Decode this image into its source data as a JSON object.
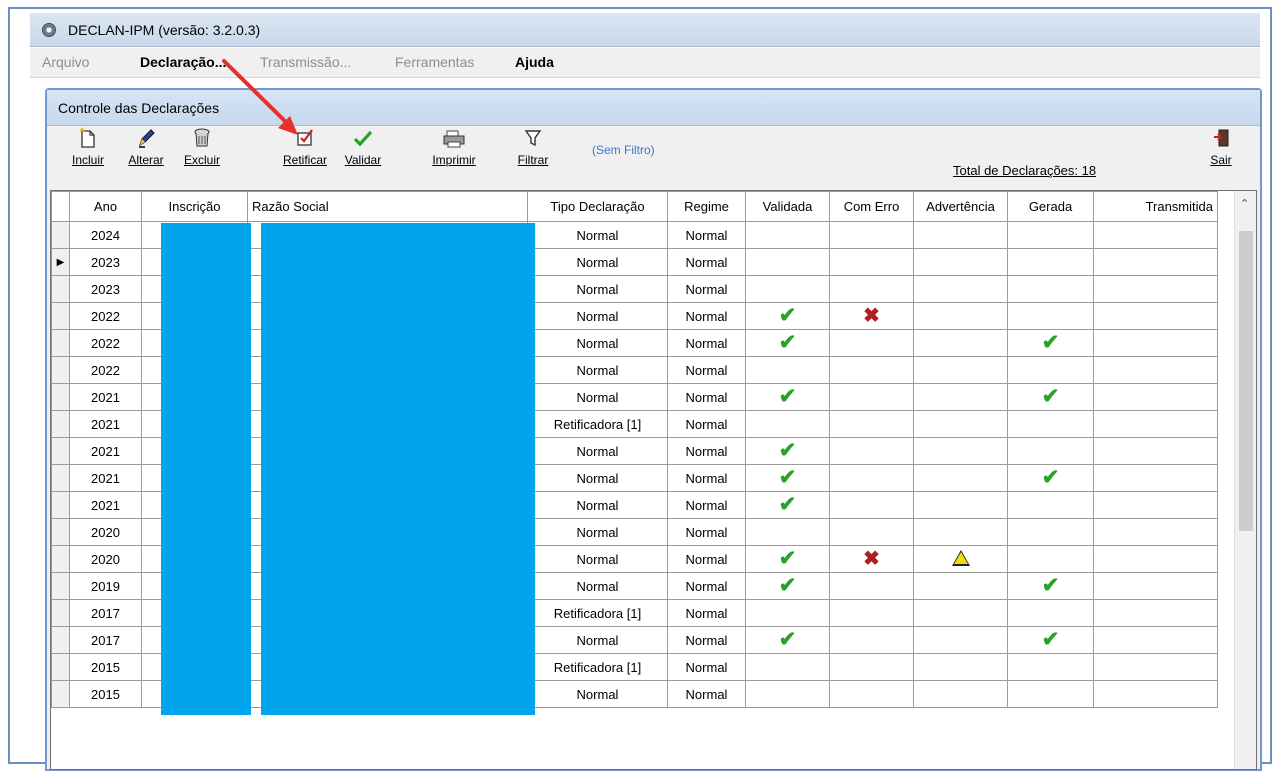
{
  "window": {
    "title": "DECLAN-IPM (versão: 3.2.0.3)"
  },
  "menu": [
    {
      "label": "Arquivo",
      "state": "disabled"
    },
    {
      "label": "Declaração...",
      "state": "bold"
    },
    {
      "label": "Transmissão...",
      "state": "disabled"
    },
    {
      "label": "Ferramentas",
      "state": "disabled"
    },
    {
      "label": "Ajuda",
      "state": "bold"
    }
  ],
  "panel": {
    "title": "Controle das Declarações"
  },
  "toolbar": {
    "incluir": "Incluir",
    "alterar": "Alterar",
    "excluir": "Excluir",
    "retificar": "Retificar",
    "validar": "Validar",
    "imprimir": "Imprimir",
    "filtrar": "Filtrar",
    "sair": "Sair",
    "filter_status": "(Sem Filtro)",
    "total": "Total de Declarações: 18"
  },
  "icons": {
    "incluir": "new-document-icon",
    "alterar": "pencil-icon",
    "excluir": "trash-icon",
    "retificar": "rectify-document-icon",
    "validar": "check-icon",
    "imprimir": "printer-icon",
    "filtrar": "funnel-icon",
    "sair": "exit-door-icon"
  },
  "colors": {
    "check": "#27a327",
    "error": "#b01f1f",
    "redaction": "#03a4ee",
    "filter_link": "#3b76c7"
  },
  "grid": {
    "columns": [
      "Ano",
      "Inscrição",
      "Razão Social",
      "Tipo Declaração",
      "Regime",
      "Validada",
      "Com Erro",
      "Advertência",
      "Gerada",
      "Transmitida"
    ],
    "rows": [
      {
        "ano": "2024",
        "tipo": "Normal",
        "regime": "Normal",
        "validada": false,
        "erro": false,
        "advertencia": false,
        "gerada": false
      },
      {
        "ano": "2023",
        "tipo": "Normal",
        "regime": "Normal",
        "validada": false,
        "erro": false,
        "advertencia": false,
        "gerada": false,
        "current": true
      },
      {
        "ano": "2023",
        "tipo": "Normal",
        "regime": "Normal",
        "validada": false,
        "erro": false,
        "advertencia": false,
        "gerada": false
      },
      {
        "ano": "2022",
        "tipo": "Normal",
        "regime": "Normal",
        "validada": true,
        "erro": true,
        "advertencia": false,
        "gerada": false
      },
      {
        "ano": "2022",
        "tipo": "Normal",
        "regime": "Normal",
        "validada": true,
        "erro": false,
        "advertencia": false,
        "gerada": true
      },
      {
        "ano": "2022",
        "tipo": "Normal",
        "regime": "Normal",
        "validada": false,
        "erro": false,
        "advertencia": false,
        "gerada": false
      },
      {
        "ano": "2021",
        "tipo": "Normal",
        "regime": "Normal",
        "validada": true,
        "erro": false,
        "advertencia": false,
        "gerada": true
      },
      {
        "ano": "2021",
        "tipo": "Retificadora [1]",
        "regime": "Normal",
        "validada": false,
        "erro": false,
        "advertencia": false,
        "gerada": false
      },
      {
        "ano": "2021",
        "tipo": "Normal",
        "regime": "Normal",
        "validada": true,
        "erro": false,
        "advertencia": false,
        "gerada": false
      },
      {
        "ano": "2021",
        "tipo": "Normal",
        "regime": "Normal",
        "validada": true,
        "erro": false,
        "advertencia": false,
        "gerada": true
      },
      {
        "ano": "2021",
        "tipo": "Normal",
        "regime": "Normal",
        "validada": true,
        "erro": false,
        "advertencia": false,
        "gerada": false
      },
      {
        "ano": "2020",
        "tipo": "Normal",
        "regime": "Normal",
        "validada": false,
        "erro": false,
        "advertencia": false,
        "gerada": false
      },
      {
        "ano": "2020",
        "tipo": "Normal",
        "regime": "Normal",
        "validada": true,
        "erro": true,
        "advertencia": true,
        "gerada": false
      },
      {
        "ano": "2019",
        "tipo": "Normal",
        "regime": "Normal",
        "validada": true,
        "erro": false,
        "advertencia": false,
        "gerada": true
      },
      {
        "ano": "2017",
        "tipo": "Retificadora [1]",
        "regime": "Normal",
        "validada": false,
        "erro": false,
        "advertencia": false,
        "gerada": false
      },
      {
        "ano": "2017",
        "tipo": "Normal",
        "regime": "Normal",
        "validada": true,
        "erro": false,
        "advertencia": false,
        "gerada": true
      },
      {
        "ano": "2015",
        "tipo": "Retificadora [1]",
        "regime": "Normal",
        "validada": false,
        "erro": false,
        "advertencia": false,
        "gerada": false
      },
      {
        "ano": "2015",
        "tipo": "Normal",
        "regime": "Normal",
        "validada": false,
        "erro": false,
        "advertencia": false,
        "gerada": false
      }
    ]
  }
}
